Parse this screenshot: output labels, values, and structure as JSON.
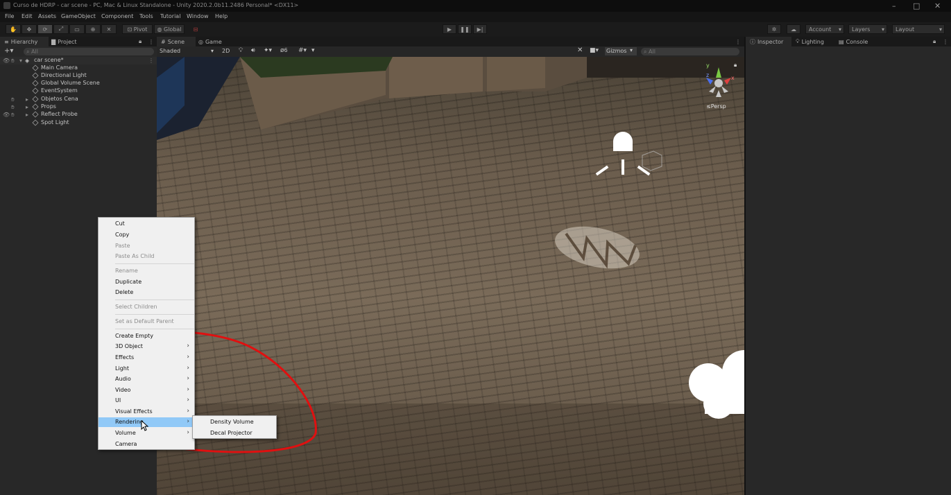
{
  "window": {
    "title": "Curso de HDRP - car scene - PC, Mac & Linux Standalone - Unity 2020.2.0b11.2486 Personal* <DX11>",
    "controls": [
      "–",
      "□",
      "✕"
    ]
  },
  "menubar": [
    "File",
    "Edit",
    "Assets",
    "GameObject",
    "Component",
    "Tools",
    "Tutorial",
    "Window",
    "Help"
  ],
  "toolbar": {
    "pivot_label": "Pivot",
    "global_label": "Global",
    "account_label": "Account",
    "layers_label": "Layers",
    "layout_label": "Layout"
  },
  "hierarchy": {
    "tabs": [
      "Hierarchy",
      "Project"
    ],
    "search_placeholder": "All",
    "scene_name": "car scene*",
    "items": [
      "Main Camera",
      "Directional Light",
      "Global Volume Scene",
      "EventSystem",
      "Objetos Cena",
      "Props",
      "Reflect Probe",
      "Spot Light"
    ]
  },
  "scene_view": {
    "tabs": [
      "Scene",
      "Game"
    ],
    "draw_mode": "Shaded",
    "mode_2d": "2D",
    "hidden_count": "6",
    "gizmos_label": "Gizmos",
    "search_placeholder": "All",
    "persp_label": "≤Persp",
    "axis_y": "y",
    "axis_x": "x",
    "axis_z": "z"
  },
  "right_panel": {
    "tabs": [
      "Inspector",
      "Lighting",
      "Console"
    ]
  },
  "context_menu": {
    "items": [
      {
        "label": "Cut",
        "disabled": false,
        "submenu": false
      },
      {
        "label": "Copy",
        "disabled": false,
        "submenu": false
      },
      {
        "label": "Paste",
        "disabled": true,
        "submenu": false
      },
      {
        "label": "Paste As Child",
        "disabled": true,
        "submenu": false
      },
      {
        "label": "Rename",
        "disabled": true,
        "submenu": false
      },
      {
        "label": "Duplicate",
        "disabled": false,
        "submenu": false
      },
      {
        "label": "Delete",
        "disabled": false,
        "submenu": false
      },
      {
        "label": "Select Children",
        "disabled": true,
        "submenu": false
      },
      {
        "label": "Set as Default Parent",
        "disabled": true,
        "submenu": false
      },
      {
        "label": "Create Empty",
        "disabled": false,
        "submenu": false
      },
      {
        "label": "3D Object",
        "disabled": false,
        "submenu": true
      },
      {
        "label": "Effects",
        "disabled": false,
        "submenu": true
      },
      {
        "label": "Light",
        "disabled": false,
        "submenu": true
      },
      {
        "label": "Audio",
        "disabled": false,
        "submenu": true
      },
      {
        "label": "Video",
        "disabled": false,
        "submenu": true
      },
      {
        "label": "UI",
        "disabled": false,
        "submenu": true
      },
      {
        "label": "Visual Effects",
        "disabled": false,
        "submenu": true
      },
      {
        "label": "Rendering",
        "disabled": false,
        "submenu": true
      },
      {
        "label": "Volume",
        "disabled": false,
        "submenu": true
      },
      {
        "label": "Camera",
        "disabled": false,
        "submenu": false
      }
    ],
    "highlighted": "Rendering",
    "submenu_items": [
      "Density Volume",
      "Decal Projector"
    ]
  },
  "colors": {
    "menu_highlight": "#91c9f7",
    "annotation_circle": "#e01010",
    "editor_bg": "#282828"
  }
}
